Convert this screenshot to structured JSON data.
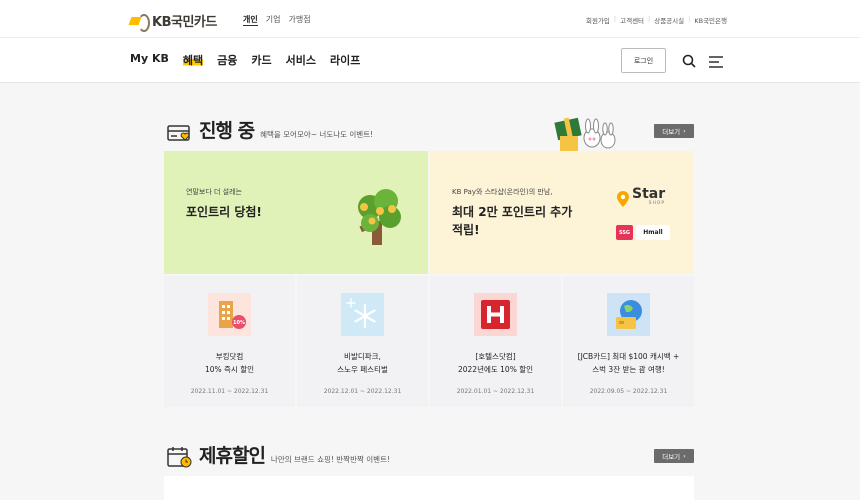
{
  "brand": {
    "logo_text": "KB국민카드",
    "accent": "#ffbc00"
  },
  "segments": [
    "개인",
    "기업",
    "가맹점"
  ],
  "utility_links": [
    "회원가입",
    "고객센터",
    "상품공시실",
    "KB국민은행"
  ],
  "menu": [
    "My KB",
    "혜택",
    "금융",
    "카드",
    "서비스",
    "라이프"
  ],
  "login_label": "로그인",
  "section1": {
    "title": "진행 중",
    "subtitle": "혜택을 모어모아~ 너도나도 이벤트!",
    "more": "더보기"
  },
  "banner_left": {
    "small": "연말보다 더 설레는",
    "big": "포인트리 당첨!"
  },
  "banner_right": {
    "small": "KB Pay와 스타샵(온라인)의 만남,",
    "big1": "최대 2만 포인트리 추가",
    "big2": "적립!",
    "star_word": "Star",
    "shop_word": "SHOP",
    "ssg": "SSG",
    "hmall": "Hmall"
  },
  "cards": [
    {
      "title1": "부킹닷컴",
      "title2": "10% 즉시 할인",
      "date": "2022.11.01 ~ 2022.12.31",
      "badge": "10%"
    },
    {
      "title1": "비발디파크,",
      "title2": "스노우 페스티벌",
      "date": "2022.12.01 ~ 2022.12.31"
    },
    {
      "title1": "[호텔스닷컴]",
      "title2": "2022년에도 10% 할인",
      "date": "2022.01.01 ~ 2022.12.31"
    },
    {
      "title1": "[JCB카드] 최대 $100 캐시백 +",
      "title2": "스벅 3잔 받는 괌 여행!",
      "date": "2022.09.05 ~ 2022.12.31"
    }
  ],
  "section2": {
    "title": "제휴할인",
    "subtitle": "나만의 브랜드 쇼핑! 반짝반짝 이벤트!",
    "more": "더보기"
  }
}
